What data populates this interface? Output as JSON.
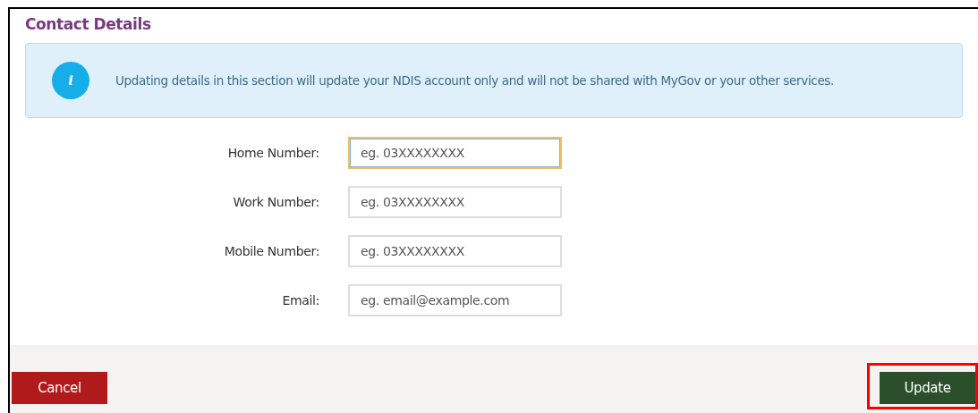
{
  "section": {
    "title": "Contact Details"
  },
  "info": {
    "icon": "i",
    "message": "Updating details in this section will update your NDIS account only and will not be shared with MyGov or your other services."
  },
  "fields": [
    {
      "label": "Home Number:",
      "placeholder": "eg. 03XXXXXXXX",
      "focused": true
    },
    {
      "label": "Work Number:",
      "placeholder": "eg. 03XXXXXXXX",
      "focused": false
    },
    {
      "label": "Mobile Number:",
      "placeholder": "eg. 03XXXXXXXX",
      "focused": false
    },
    {
      "label": "Email:",
      "placeholder": "eg. email@example.com",
      "focused": false
    }
  ],
  "buttons": [
    {
      "label": "Cancel",
      "kind": "cancel",
      "highlighted": false
    },
    {
      "label": "Update",
      "kind": "submit",
      "highlighted": true
    }
  ]
}
